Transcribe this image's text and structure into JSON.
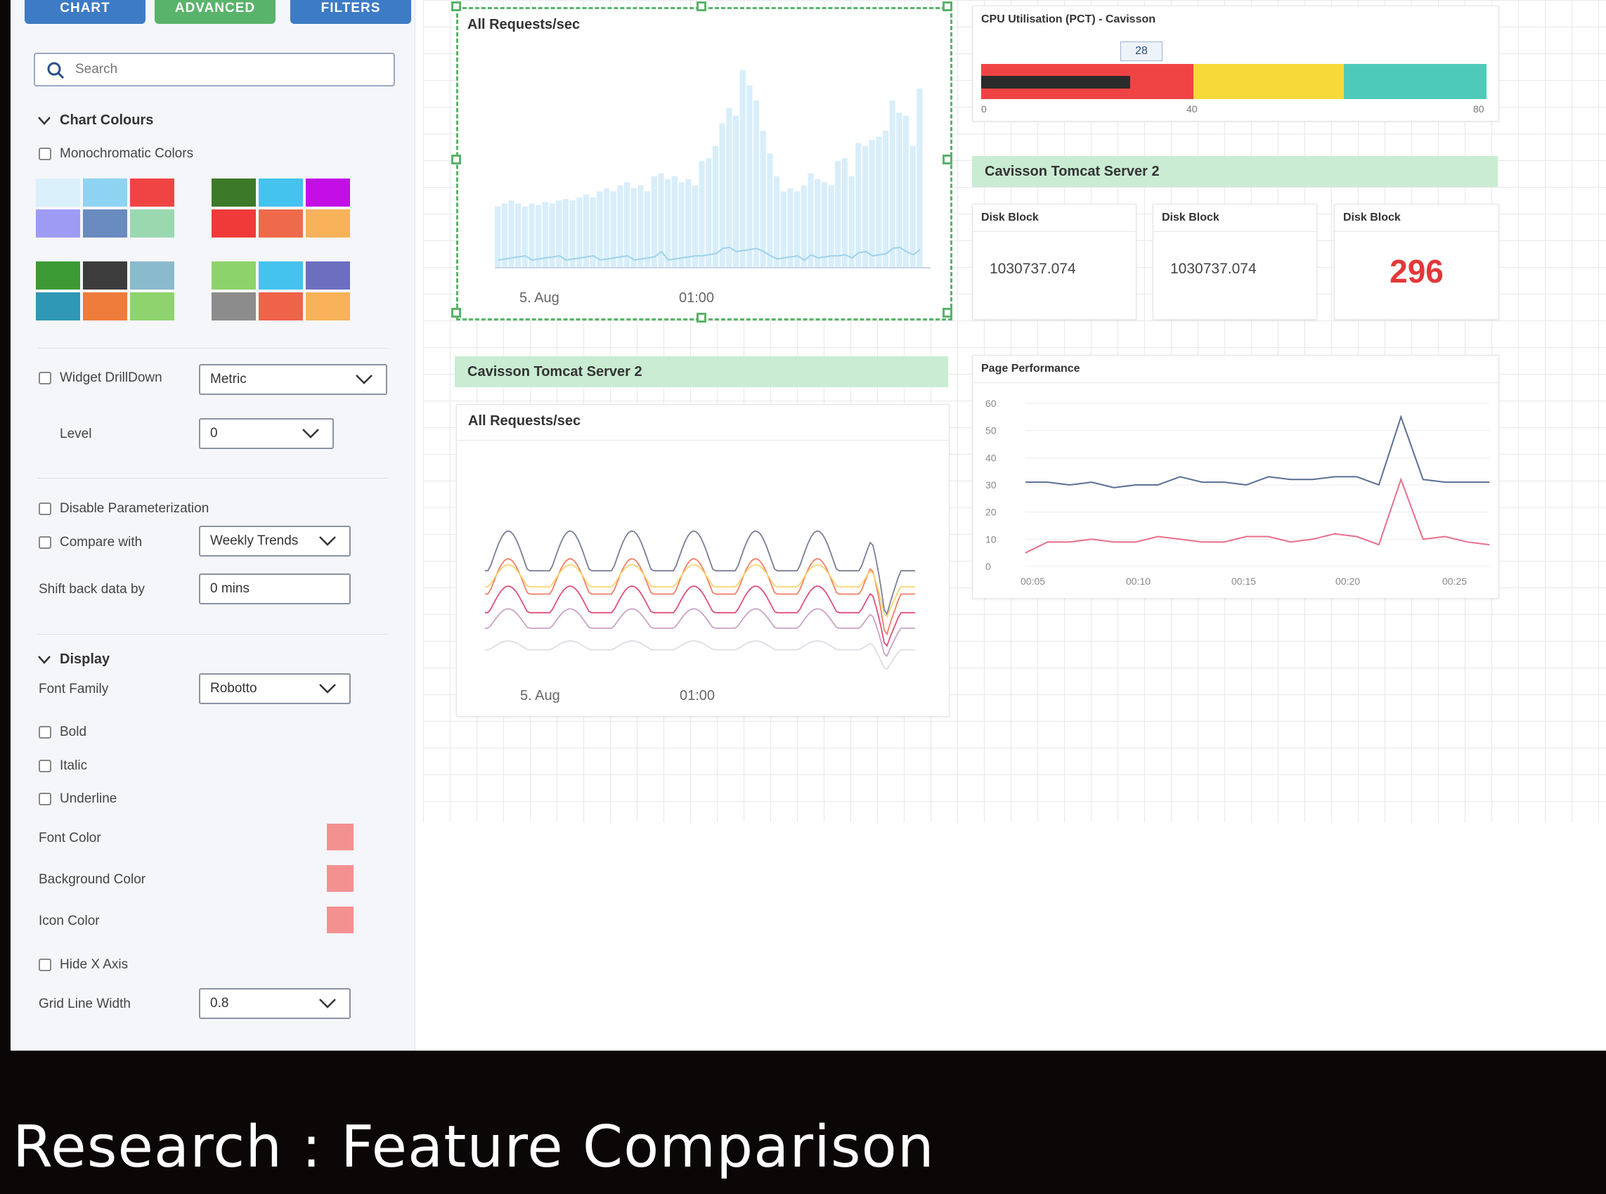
{
  "tabs": [
    "CHART",
    "ADVANCED",
    "FILTERS"
  ],
  "search": {
    "placeholder": "Search"
  },
  "chart_colours": {
    "title": "Chart Colours",
    "monochromatic_label": "Monochromatic Colors",
    "palettes": [
      [
        "#daf0fb",
        "#8fd3f2",
        "#f04444",
        "#9e9bf4",
        "#6a8bbf",
        "#9ad8b0"
      ],
      [
        "#3c7a2a",
        "#44c3ee",
        "#c30ee6",
        "#f03a3a",
        "#ee6a4a",
        "#f7b25a"
      ],
      [
        "#3c9a34",
        "#3c3c3c",
        "#8abbcc",
        "#2f98b5",
        "#ef7c3a",
        "#8ed36d"
      ],
      [
        "#8dd36c",
        "#44c3ee",
        "#6c6fc0",
        "#8c8c8c",
        "#ee634a",
        "#f7b25a"
      ]
    ]
  },
  "drilldown": {
    "label": "Widget DrillDown",
    "value": "Metric",
    "level_label": "Level",
    "level_value": "0"
  },
  "parameters": {
    "disable_label": "Disable Parameterization",
    "compare_label": "Compare with",
    "compare_value": "Weekly Trends",
    "shift_label": "Shift back data by",
    "shift_value": "0 mins"
  },
  "display": {
    "title": "Display",
    "font_family_label": "Font Family",
    "font_family_value": "Robotto",
    "bold": "Bold",
    "italic": "Italic",
    "underline": "Underline",
    "font_color_label": "Font Color",
    "bg_color_label": "Background Color",
    "icon_color_label": "Icon Color",
    "swatch_color": "#f39191",
    "hide_x_label": "Hide X Axis",
    "grid_width_label": "Grid Line Width",
    "grid_width_value": "0.8"
  },
  "widgets": {
    "requests_title": "All Requests/sec",
    "x_label_1": "5. Aug",
    "x_label_2": "01:00",
    "group_title": "Cavisson Tomcat Server 2",
    "cpu": {
      "title": "CPU Utilisation (PCT) - Cavisson",
      "marker_value": "28",
      "ticks": [
        "0",
        "40",
        "80"
      ]
    },
    "disk_blocks": [
      {
        "title": "Disk Block",
        "value": "1030737.074"
      },
      {
        "title": "Disk Block",
        "value": "1030737.074"
      },
      {
        "title": "Disk Block",
        "value": "296"
      }
    ],
    "page_perf_title": "Page Performance"
  },
  "chart_data": [
    {
      "type": "bar",
      "title": "All Requests/sec",
      "x_tick_labels": [
        "5. Aug",
        "01:00"
      ],
      "values": [
        40,
        42,
        44,
        42,
        40,
        42,
        41,
        43,
        42,
        44,
        45,
        44,
        46,
        48,
        46,
        50,
        52,
        50,
        54,
        56,
        52,
        54,
        50,
        60,
        62,
        58,
        60,
        56,
        58,
        54,
        70,
        72,
        80,
        95,
        105,
        100,
        130,
        120,
        110,
        90,
        75,
        60,
        50,
        52,
        50,
        54,
        62,
        58,
        56,
        54,
        70,
        72,
        60,
        82,
        80,
        84,
        86,
        90,
        110,
        102,
        100,
        80,
        118
      ]
    },
    {
      "type": "line",
      "title": "All Requests/sec",
      "x_tick_labels": [
        "5. Aug",
        "01:00"
      ]
    },
    {
      "type": "line",
      "title": "Page Performance",
      "categories": [
        "00:05",
        "00:06",
        "00:07",
        "00:08",
        "00:09",
        "00:10",
        "00:11",
        "00:12",
        "00:13",
        "00:14",
        "00:15",
        "00:16",
        "00:17",
        "00:18",
        "00:19",
        "00:20",
        "00:21",
        "00:22",
        "00:23",
        "00:24",
        "00:25",
        "00:26"
      ],
      "series": [
        {
          "values": [
            31,
            31,
            30,
            31,
            29,
            30,
            30,
            33,
            31,
            31,
            30,
            33,
            32,
            32,
            33,
            33,
            30,
            55,
            32,
            31,
            31,
            31
          ],
          "color": "#5a6f95"
        },
        {
          "values": [
            5,
            9,
            9,
            10,
            9,
            9,
            11,
            10,
            9,
            9,
            11,
            11,
            9,
            10,
            12,
            11,
            8,
            32,
            10,
            11,
            9,
            8
          ],
          "color": "#e86f8a"
        }
      ],
      "ylim": [
        0,
        60
      ],
      "y_ticks": [
        0,
        10,
        20,
        30,
        40,
        50,
        60
      ],
      "x_tick_labels": [
        "00:05",
        "00:10",
        "00:15",
        "00:20",
        "00:25"
      ]
    }
  ]
}
